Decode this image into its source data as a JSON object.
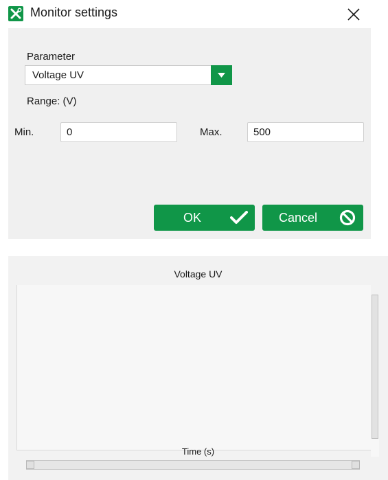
{
  "window": {
    "title": "Monitor settings",
    "icon": "tools-icon",
    "accent_color": "#109648"
  },
  "form": {
    "parameter_label": "Parameter",
    "parameter_value": "Voltage UV",
    "range_label": "Range: (V)",
    "min_label": "Min.",
    "min_value": "0",
    "max_label": "Max.",
    "max_value": "500"
  },
  "buttons": {
    "ok_label": "OK",
    "ok_icon": "checkmark-icon",
    "cancel_label": "Cancel",
    "cancel_icon": "prohibited-icon"
  },
  "chart": {
    "title": "Voltage UV",
    "xlabel": "Time (s)"
  },
  "chart_data": {
    "type": "line",
    "title": "Voltage UV",
    "xlabel": "Time (s)",
    "series": [],
    "grid": false
  }
}
